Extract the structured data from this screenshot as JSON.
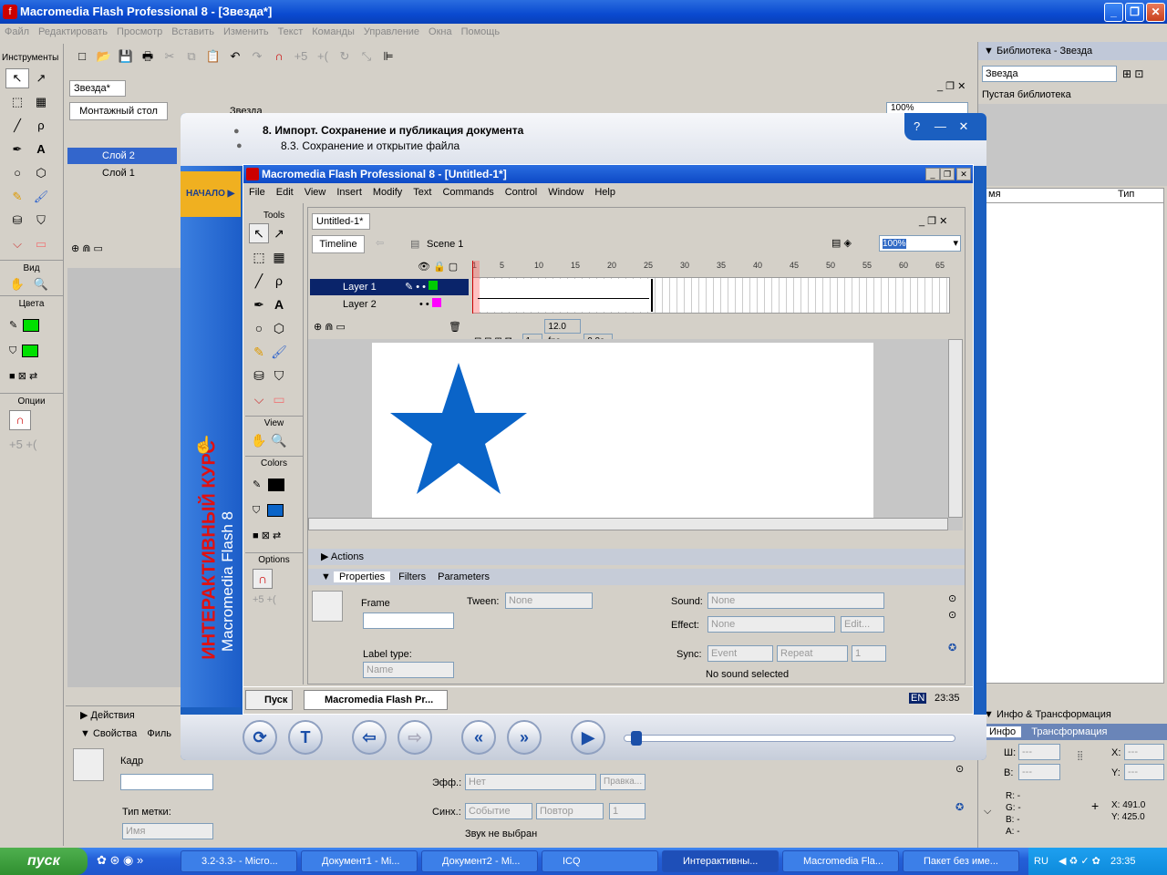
{
  "window": {
    "title": "Macromedia Flash Professional 8 - [Звезда*]"
  },
  "menu": [
    "Файл",
    "Редактировать",
    "Просмотр",
    "Вставить",
    "Изменить",
    "Текст",
    "Команды",
    "Управление",
    "Окна",
    "Помощь"
  ],
  "tools": {
    "title": "Инструменты",
    "view": "Вид",
    "colors": "Цвета",
    "options": "Опции"
  },
  "doc": {
    "tab": "Звезда*",
    "stage_btn": "Монтажный стол",
    "scene": "Звезда",
    "zoom": "100%",
    "layers": [
      "Слой 2",
      "Слой 1"
    ]
  },
  "lower": {
    "actions": "Действия",
    "props": "Свойства",
    "filters": "Филь",
    "frame": "Кадр",
    "labeltype": "Тип метки:",
    "name_ph": "Имя",
    "effect": "Эфф.:",
    "effect_val": "Нет",
    "edit": "Правка...",
    "sync": "Синх.:",
    "sync_val": "Событие",
    "repeat": "Повтор",
    "count": "1",
    "nosound": "Звук не выбран"
  },
  "library": {
    "title": "Библиотека - Звезда",
    "select": "Звезда",
    "empty": "Пустая библиотека",
    "col_name": "мя",
    "col_type": "Тип"
  },
  "info": {
    "title": "Инфо & Трансформация",
    "tab1": "Инфо",
    "tab2": "Трансформация",
    "w": "Ш:",
    "h": "В:",
    "x": "X:",
    "y": "Y:",
    "dash": "---",
    "r": "R: -",
    "g": "G: -",
    "b": "B: -",
    "a": "A: -",
    "xv": "X:  491.0",
    "yv": "Y:  425.0"
  },
  "dialog": {
    "heading": "8. Импорт. Сохранение и публикация документа",
    "sub": "8.3. Сохранение и открытие файла",
    "start": "НАЧАЛО",
    "course": "ИНТЕРАКТИВНЫЙ КУРС",
    "product": "Macromedia Flash 8",
    "help": "?"
  },
  "inner": {
    "title": "Macromedia Flash Professional 8 - [Untitled-1*]",
    "menu": [
      "File",
      "Edit",
      "View",
      "Insert",
      "Modify",
      "Text",
      "Commands",
      "Control",
      "Window",
      "Help"
    ],
    "tools": "Tools",
    "view": "View",
    "colors": "Colors",
    "options": "Options",
    "doctab": "Untitled-1*",
    "timeline": "Timeline",
    "scene": "Scene 1",
    "zoom": "100%",
    "layers": [
      "Layer 1",
      "Layer 2"
    ],
    "ruler": [
      "1",
      "5",
      "10",
      "15",
      "20",
      "25",
      "30",
      "35",
      "40",
      "45",
      "50",
      "55",
      "60",
      "65"
    ],
    "frame": "1",
    "fps": "12.0 fps",
    "time": "0.0s",
    "actions": "Actions",
    "tabs": [
      "Properties",
      "Filters",
      "Parameters"
    ],
    "p_frame": "Frame",
    "tween": "Tween:",
    "tween_val": "None",
    "sound": "Sound:",
    "sound_val": "None",
    "effect": "Effect:",
    "effect_val": "None",
    "edit": "Edit...",
    "labeltype": "Label type:",
    "name_ph": "Name",
    "sync": "Sync:",
    "sync_val": "Event",
    "repeat": "Repeat",
    "count": "1",
    "nosound": "No sound selected",
    "start": "Пуск",
    "task": "Macromedia Flash Pr...",
    "lang": "EN",
    "clock": "23:35"
  },
  "taskbar": {
    "start": "пуск",
    "items": [
      "3.2-3.3- - Micro...",
      "Документ1 - Mi...",
      "Документ2 - Mi...",
      "ICQ",
      "Интерактивны...",
      "Macromedia Fla...",
      "Пакет без име..."
    ],
    "lang": "RU",
    "clock": "23:35"
  },
  "colors": {
    "star": "#0a64c8",
    "stroke": "#00c000"
  }
}
